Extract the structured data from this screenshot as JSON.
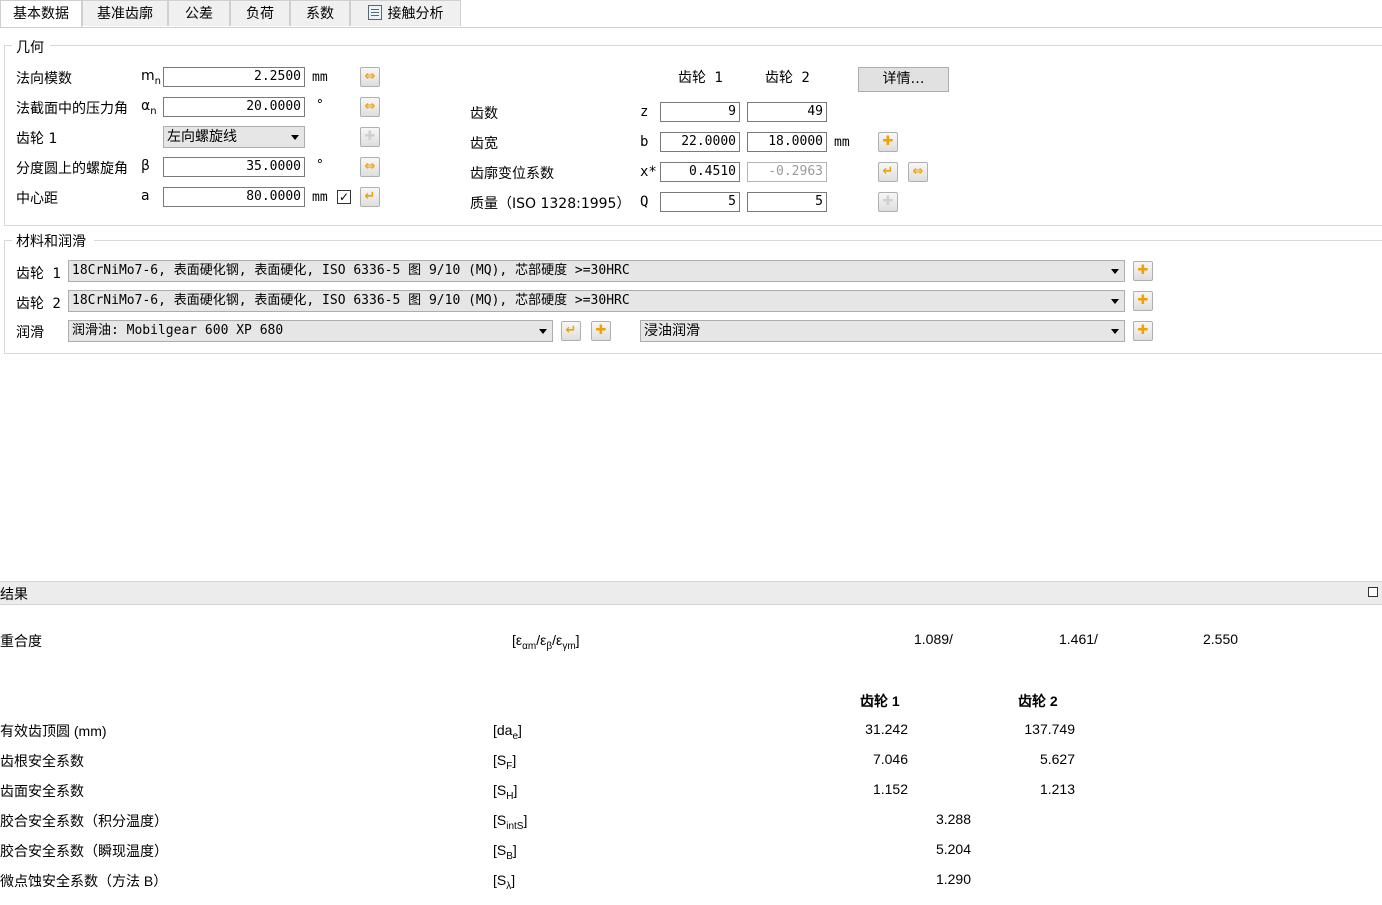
{
  "tabs": [
    "基本数据",
    "基准齿廓",
    "公差",
    "负荷",
    "系数",
    "接触分析"
  ],
  "geometry": {
    "title": "几何",
    "rows": [
      {
        "label": "法向模数",
        "sym": "m",
        "sub": "n",
        "value": "2.2500",
        "unit": "mm"
      },
      {
        "label": "法截面中的压力角",
        "sym": "α",
        "sub": "n",
        "value": "20.0000",
        "unit": "°"
      },
      {
        "label": "齿轮 1",
        "sym": "",
        "sub": "",
        "value": "左向螺旋线",
        "unit": ""
      },
      {
        "label": "分度圆上的螺旋角",
        "sym": "β",
        "sub": "",
        "value": "35.0000",
        "unit": "°"
      },
      {
        "label": "中心距",
        "sym": "a",
        "sub": "",
        "value": "80.0000",
        "unit": "mm"
      }
    ],
    "checkbox_mark": "✓",
    "gear1_header": "齿轮 1",
    "gear2_header": "齿轮 2",
    "details_button": "详情…",
    "right_rows": [
      {
        "label": "齿数",
        "sym": "z",
        "v1": "9",
        "v2": "49",
        "unit": ""
      },
      {
        "label": "齿宽",
        "sym": "b",
        "v1": "22.0000",
        "v2": "18.0000",
        "unit": "mm"
      },
      {
        "label": "齿廓变位系数",
        "sym": "x*",
        "v1": "0.4510",
        "v2": "-0.2963",
        "unit": ""
      },
      {
        "label": "质量（ISO 1328:1995）",
        "sym": "Q",
        "v1": "5",
        "v2": "5",
        "unit": ""
      }
    ]
  },
  "material": {
    "title": "材料和润滑",
    "gear1_label": "齿轮 1",
    "gear1_value": "18CrNiMo7-6, 表面硬化钢, 表面硬化, ISO 6336-5 图 9/10 (MQ), 芯部硬度 >=30HRC",
    "gear2_label": "齿轮 2",
    "gear2_value": "18CrNiMo7-6, 表面硬化钢, 表面硬化, ISO 6336-5 图 9/10 (MQ), 芯部硬度 >=30HRC",
    "lub_label": "润滑",
    "lub_value": "润滑油: Mobilgear 600 XP 680",
    "lub_type": "浸油润滑"
  },
  "results": {
    "title": "结果",
    "contact_ratio_label": "重合度",
    "contact_ratio_values": [
      "1.089/",
      "1.461/",
      "2.550"
    ],
    "gear1_header": "齿轮 1",
    "gear2_header": "齿轮 2",
    "rows": [
      {
        "label": "有效齿顶圆 (mm)",
        "v1": "31.242",
        "v2": "137.749"
      },
      {
        "label": "齿根安全系数",
        "v1": "7.046",
        "v2": "5.627"
      },
      {
        "label": "齿面安全系数",
        "v1": "1.152",
        "v2": "1.213"
      }
    ],
    "single_rows": [
      {
        "label": "胶合安全系数（积分温度）",
        "v": "3.288"
      },
      {
        "label": "胶合安全系数（瞬现温度）",
        "v": "5.204"
      },
      {
        "label": "微点蚀安全系数（方法 B）",
        "v": "1.290"
      }
    ]
  }
}
